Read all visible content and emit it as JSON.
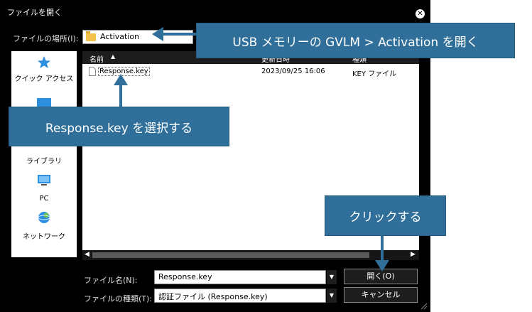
{
  "dialog": {
    "title": "ファイルを開く",
    "close_symbol": "✕"
  },
  "location": {
    "label": "ファイルの場所(I):",
    "value": "Activation"
  },
  "sidebar": {
    "items": [
      {
        "label": "クイック アクセス",
        "icon": "star-icon"
      },
      {
        "label": "ライブラリ",
        "icon": "library-icon"
      },
      {
        "label": "PC",
        "icon": "pc-icon"
      },
      {
        "label": "ネットワーク",
        "icon": "network-icon"
      }
    ]
  },
  "list": {
    "columns": [
      "名前",
      "更新日時",
      "種類"
    ],
    "rows": [
      {
        "name": "Response.key",
        "modified": "2023/09/25 16:06",
        "type": "KEY ファイル"
      }
    ]
  },
  "filename": {
    "label": "ファイル名(N):",
    "value": "Response.key"
  },
  "filetype": {
    "label": "ファイルの種類(T):",
    "value": "認証ファイル (Response.key)"
  },
  "buttons": {
    "open": "開く(O)",
    "cancel": "キャンセル"
  },
  "callouts": {
    "top": "USB メモリーの GVLM > Activation を開く",
    "middle": "Response.key を選択する",
    "bottom": "クリックする"
  },
  "colors": {
    "callout_bg": "#2f6f99",
    "folder": "#f2c24c"
  }
}
